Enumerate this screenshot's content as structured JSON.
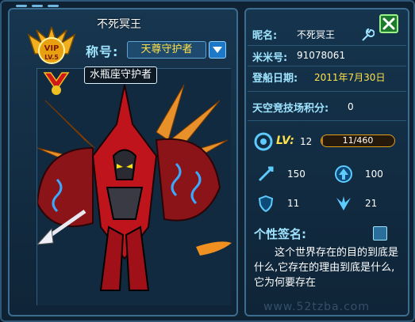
{
  "player": {
    "name": "不死冥王",
    "title_label": "称号:",
    "title_value": "天尊守护者",
    "tooltip": "水瓶座守护者",
    "vip_level": "VIP LV.5"
  },
  "info": {
    "nickname_label": "昵名:",
    "nickname_value": "不死冥王",
    "id_label": "米米号:",
    "id_value": "91078061",
    "date_label": "登船日期:",
    "date_value": "2011年7月30日",
    "arena_label": "天空竞技场积分:",
    "arena_value": "0"
  },
  "level": {
    "label": "LV:",
    "value": "12",
    "exp_text": "11/460",
    "exp_current": 11,
    "exp_max": 460
  },
  "stats": {
    "stat1": "150",
    "stat2": "100",
    "stat3": "11",
    "stat4": "21"
  },
  "signature": {
    "label": "个性签名:",
    "text": "这个世界存在的目的到底是什么,它存在的理由到底是什么,它为何要存在"
  },
  "watermark": "www.52tzba.com",
  "colors": {
    "accent_blue": "#9fe4ff",
    "accent_yellow": "#ffe24a",
    "close_green": "#1d7a2d"
  }
}
